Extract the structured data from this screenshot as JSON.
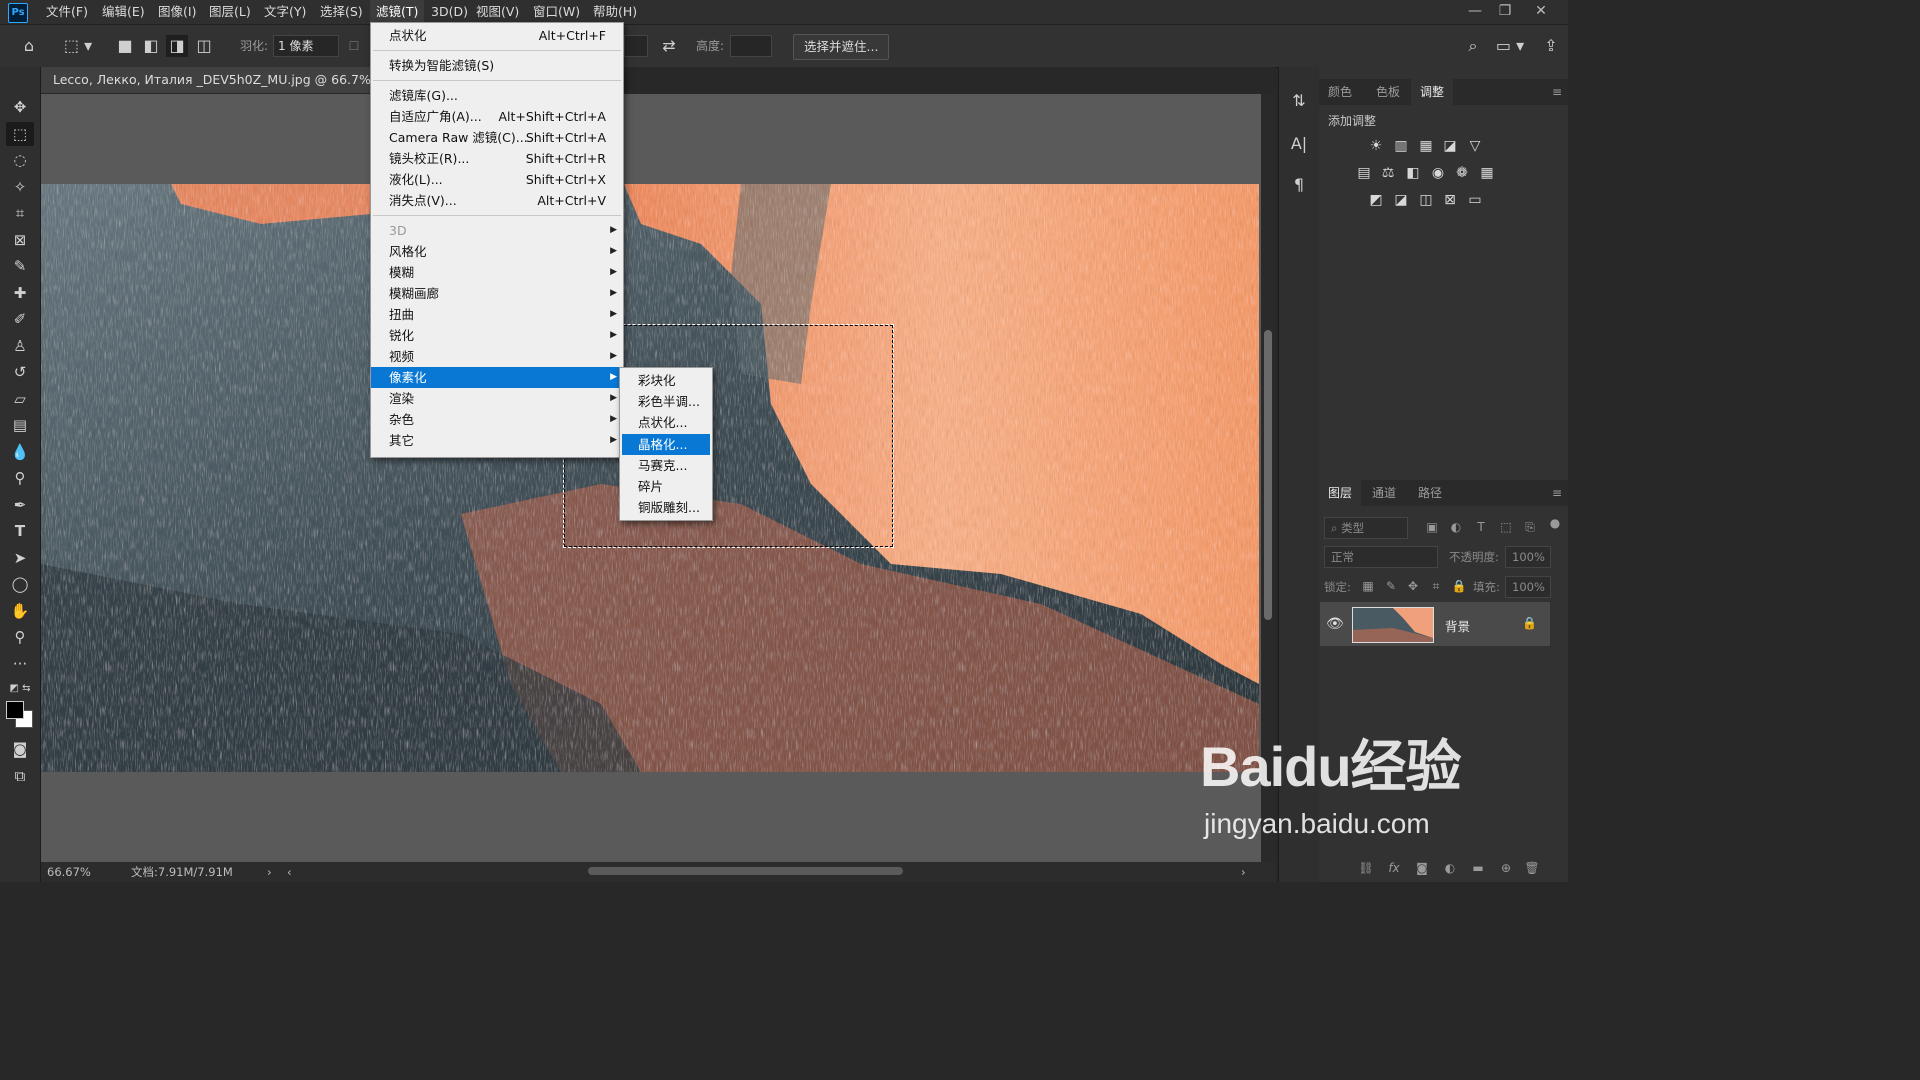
{
  "app": {
    "logo": "Ps"
  },
  "menubar": {
    "items": [
      "文件(F)",
      "编辑(E)",
      "图像(I)",
      "图层(L)",
      "文字(Y)",
      "选择(S)",
      "滤镜(T)",
      "3D(D)",
      "视图(V)",
      "窗口(W)",
      "帮助(H)"
    ],
    "active": "滤镜(T)"
  },
  "window_controls": {
    "minimize": "—",
    "restore": "❐",
    "close": "✕"
  },
  "options_bar": {
    "feather_label": "羽化:",
    "feather_value": "1 像素",
    "height_label": "高度:",
    "select_mask_button": "选择并遮住..."
  },
  "document": {
    "tab_title": "Lecco, Лекко, Италия _DEV5h0Z_MU.jpg @ 66.7%(RGB/8)",
    "zoom": "66.67%",
    "doc_info": "文档:7.91M/7.91M"
  },
  "filter_menu": {
    "items": [
      {
        "label": "点状化",
        "shortcut": "Alt+Ctrl+F"
      },
      {
        "sep": true
      },
      {
        "label": "转换为智能滤镜(S)"
      },
      {
        "sep": true
      },
      {
        "label": "滤镜库(G)..."
      },
      {
        "label": "自适应广角(A)...",
        "shortcut": "Alt+Shift+Ctrl+A"
      },
      {
        "label": "Camera Raw 滤镜(C)...",
        "shortcut": "Shift+Ctrl+A"
      },
      {
        "label": "镜头校正(R)...",
        "shortcut": "Shift+Ctrl+R"
      },
      {
        "label": "液化(L)...",
        "shortcut": "Shift+Ctrl+X"
      },
      {
        "label": "消失点(V)...",
        "shortcut": "Alt+Ctrl+V"
      },
      {
        "sep": true
      },
      {
        "label": "3D",
        "submenu": true,
        "disabled": true
      },
      {
        "label": "风格化",
        "submenu": true
      },
      {
        "label": "模糊",
        "submenu": true
      },
      {
        "label": "模糊画廊",
        "submenu": true
      },
      {
        "label": "扭曲",
        "submenu": true
      },
      {
        "label": "锐化",
        "submenu": true
      },
      {
        "label": "视频",
        "submenu": true
      },
      {
        "label": "像素化",
        "submenu": true,
        "highlighted": true
      },
      {
        "label": "渲染",
        "submenu": true
      },
      {
        "label": "杂色",
        "submenu": true
      },
      {
        "label": "其它",
        "submenu": true
      }
    ]
  },
  "pixelate_submenu": {
    "items": [
      "彩块化",
      "彩色半调...",
      "点状化...",
      "晶格化...",
      "马赛克...",
      "碎片",
      "铜版雕刻..."
    ],
    "highlighted": "晶格化..."
  },
  "adjust_panel": {
    "tabs": [
      "颜色",
      "色板",
      "调整"
    ],
    "active_tab": "调整",
    "heading": "添加调整"
  },
  "layers_panel": {
    "tabs": [
      "图层",
      "通道",
      "路径"
    ],
    "active_tab": "图层",
    "filter_placeholder": "类型",
    "blend_mode": "正常",
    "opacity_label": "不透明度:",
    "opacity_value": "100%",
    "lock_label": "锁定:",
    "fill_label": "填充:",
    "fill_value": "100%",
    "layer_name": "背景"
  },
  "watermark": {
    "line1": "Baidu经验",
    "line2": "jingyan.baidu.com"
  },
  "colors": {
    "accent": "#0878d4",
    "menu_bg": "#efefef",
    "app_bg": "#323232",
    "canvas_bg": "#5a5a5a"
  }
}
